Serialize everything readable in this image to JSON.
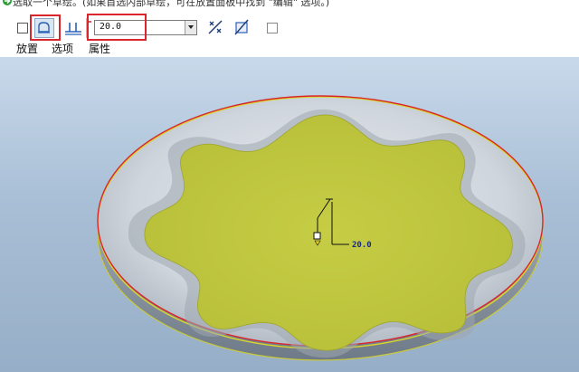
{
  "prompt": {
    "text": "选取一个草绘。(如果首选内部草绘，可在放置面板中找到 \"编辑\" 选项。)",
    "icon": "green-arrow-icon"
  },
  "toolbar": {
    "offset_value": "20.0",
    "icons": [
      "solid-checkbox-icon",
      "surface-mode-icon",
      "thicken-icon",
      "flip-direction-icon",
      "dimension-sketch-icon",
      "remove-material-icon"
    ]
  },
  "tabs": [
    {
      "label": "放置"
    },
    {
      "label": "选项"
    },
    {
      "label": "属性"
    }
  ],
  "viewport": {
    "dimension_label": "20.0"
  },
  "colors": {
    "highlight_red": "#d9262c",
    "surface_yellow": "#c8cf4a",
    "disc_grey": "#c9cfd6",
    "viewport_bg": "#a9bfd6"
  }
}
